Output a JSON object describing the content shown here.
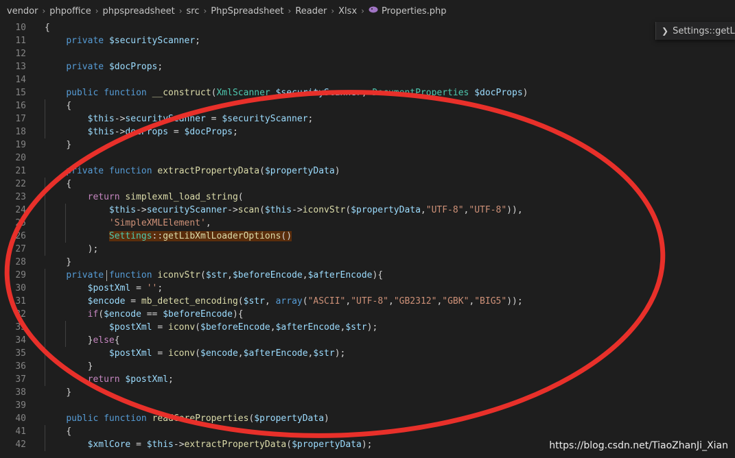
{
  "breadcrumb": {
    "items": [
      "vendor",
      "phpoffice",
      "phpspreadsheet",
      "src",
      "PhpSpreadsheet",
      "Reader",
      "Xlsx"
    ],
    "file": "Properties.php",
    "separator": "›"
  },
  "sticky_widget": {
    "label": "Settings::getLibX"
  },
  "watermark": "https://blog.csdn.net/TiaoZhanJi_Xian",
  "colors": {
    "background": "#1e1e1e",
    "keyword": "#569cd6",
    "control": "#c586c0",
    "variable": "#9cdcfe",
    "function": "#dcdcaa",
    "string": "#ce9178",
    "class": "#4ec9b0",
    "annotation_circle": "#e8302a"
  },
  "lines": [
    {
      "n": "10",
      "tokens": [
        [
          "pun",
          "{"
        ]
      ]
    },
    {
      "n": "11",
      "tokens": [
        [
          "sp",
          "    "
        ],
        [
          "kw",
          "private"
        ],
        [
          "sp",
          " "
        ],
        [
          "var",
          "$securityScanner"
        ],
        [
          "pun",
          ";"
        ]
      ]
    },
    {
      "n": "12",
      "tokens": []
    },
    {
      "n": "13",
      "tokens": [
        [
          "sp",
          "    "
        ],
        [
          "kw",
          "private"
        ],
        [
          "sp",
          " "
        ],
        [
          "var",
          "$docProps"
        ],
        [
          "pun",
          ";"
        ]
      ]
    },
    {
      "n": "14",
      "tokens": []
    },
    {
      "n": "15",
      "tokens": [
        [
          "sp",
          "    "
        ],
        [
          "kw",
          "public"
        ],
        [
          "sp",
          " "
        ],
        [
          "kw",
          "function"
        ],
        [
          "sp",
          " "
        ],
        [
          "fn",
          "__construct"
        ],
        [
          "pun",
          "("
        ],
        [
          "cls",
          "XmlScanner"
        ],
        [
          "sp",
          " "
        ],
        [
          "var",
          "$securityScanner"
        ],
        [
          "pun",
          ", "
        ],
        [
          "cls",
          "DocumentProperties"
        ],
        [
          "sp",
          " "
        ],
        [
          "var",
          "$docProps"
        ],
        [
          "pun",
          ")"
        ]
      ]
    },
    {
      "n": "16",
      "tokens": [
        [
          "sp",
          "    "
        ],
        [
          "pun",
          "{"
        ]
      ]
    },
    {
      "n": "17",
      "tokens": [
        [
          "sp",
          "        "
        ],
        [
          "var",
          "$this"
        ],
        [
          "pun",
          "->"
        ],
        [
          "var",
          "securityScanner"
        ],
        [
          "pun",
          " = "
        ],
        [
          "var",
          "$securityScanner"
        ],
        [
          "pun",
          ";"
        ]
      ]
    },
    {
      "n": "18",
      "tokens": [
        [
          "sp",
          "        "
        ],
        [
          "var",
          "$this"
        ],
        [
          "pun",
          "->"
        ],
        [
          "var",
          "docProps"
        ],
        [
          "pun",
          " = "
        ],
        [
          "var",
          "$docProps"
        ],
        [
          "pun",
          ";"
        ]
      ]
    },
    {
      "n": "19",
      "tokens": [
        [
          "sp",
          "    "
        ],
        [
          "pun",
          "}"
        ]
      ]
    },
    {
      "n": "20",
      "tokens": []
    },
    {
      "n": "21",
      "tokens": [
        [
          "sp",
          "    "
        ],
        [
          "kw",
          "private"
        ],
        [
          "sp",
          " "
        ],
        [
          "kw",
          "function"
        ],
        [
          "sp",
          " "
        ],
        [
          "fn",
          "extractPropertyData"
        ],
        [
          "pun",
          "("
        ],
        [
          "var",
          "$propertyData"
        ],
        [
          "pun",
          ")"
        ]
      ]
    },
    {
      "n": "22",
      "tokens": [
        [
          "sp",
          "    "
        ],
        [
          "pun",
          "{"
        ]
      ]
    },
    {
      "n": "23",
      "tokens": [
        [
          "sp",
          "        "
        ],
        [
          "ctl",
          "return"
        ],
        [
          "sp",
          " "
        ],
        [
          "fn",
          "simplexml_load_string"
        ],
        [
          "pun",
          "("
        ]
      ]
    },
    {
      "n": "24",
      "tokens": [
        [
          "sp",
          "            "
        ],
        [
          "var",
          "$this"
        ],
        [
          "pun",
          "->"
        ],
        [
          "var",
          "securityScanner"
        ],
        [
          "pun",
          "->"
        ],
        [
          "fn",
          "scan"
        ],
        [
          "pun",
          "("
        ],
        [
          "var",
          "$this"
        ],
        [
          "pun",
          "->"
        ],
        [
          "fn",
          "iconvStr"
        ],
        [
          "pun",
          "("
        ],
        [
          "var",
          "$propertyData"
        ],
        [
          "pun",
          ","
        ],
        [
          "str",
          "\"UTF-8\""
        ],
        [
          "pun",
          ","
        ],
        [
          "str",
          "\"UTF-8\""
        ],
        [
          "pun",
          ")),"
        ]
      ]
    },
    {
      "n": "25",
      "tokens": [
        [
          "sp",
          "            "
        ],
        [
          "str",
          "'SimpleXMLElement'"
        ],
        [
          "pun",
          ","
        ]
      ]
    },
    {
      "n": "26",
      "tokens": [
        [
          "sp",
          "            "
        ],
        [
          "hlcls",
          "Settings"
        ],
        [
          "hlpun",
          "::"
        ],
        [
          "hlfn",
          "getLibXmlLoaderOptions"
        ],
        [
          "hlpun",
          "()"
        ]
      ]
    },
    {
      "n": "27",
      "tokens": [
        [
          "sp",
          "        "
        ],
        [
          "pun",
          ");"
        ]
      ]
    },
    {
      "n": "28",
      "tokens": [
        [
          "sp",
          "    "
        ],
        [
          "pun",
          "}"
        ]
      ]
    },
    {
      "n": "29",
      "tokens": [
        [
          "sp",
          "    "
        ],
        [
          "kw",
          "private"
        ],
        [
          "sp",
          " "
        ],
        [
          "kw",
          "function"
        ],
        [
          "sp",
          " "
        ],
        [
          "fn",
          "iconvStr"
        ],
        [
          "pun",
          "("
        ],
        [
          "var",
          "$str"
        ],
        [
          "pun",
          ","
        ],
        [
          "var",
          "$beforeEncode"
        ],
        [
          "pun",
          ","
        ],
        [
          "var",
          "$afterEncode"
        ],
        [
          "pun",
          "){"
        ]
      ]
    },
    {
      "n": "30",
      "tokens": [
        [
          "sp",
          "        "
        ],
        [
          "var",
          "$postXml"
        ],
        [
          "pun",
          " = "
        ],
        [
          "str",
          "''"
        ],
        [
          "pun",
          ";"
        ]
      ]
    },
    {
      "n": "31",
      "tokens": [
        [
          "sp",
          "        "
        ],
        [
          "var",
          "$encode"
        ],
        [
          "pun",
          " = "
        ],
        [
          "fn",
          "mb_detect_encoding"
        ],
        [
          "pun",
          "("
        ],
        [
          "var",
          "$str"
        ],
        [
          "pun",
          ", "
        ],
        [
          "kw",
          "array"
        ],
        [
          "pun",
          "("
        ],
        [
          "str",
          "\"ASCII\""
        ],
        [
          "pun",
          ","
        ],
        [
          "str",
          "\"UTF-8\""
        ],
        [
          "pun",
          ","
        ],
        [
          "str",
          "\"GB2312\""
        ],
        [
          "pun",
          ","
        ],
        [
          "str",
          "\"GBK\""
        ],
        [
          "pun",
          ","
        ],
        [
          "str",
          "\"BIG5\""
        ],
        [
          "pun",
          "));"
        ]
      ]
    },
    {
      "n": "32",
      "tokens": [
        [
          "sp",
          "        "
        ],
        [
          "ctl",
          "if"
        ],
        [
          "pun",
          "("
        ],
        [
          "var",
          "$encode"
        ],
        [
          "pun",
          " == "
        ],
        [
          "var",
          "$beforeEncode"
        ],
        [
          "pun",
          "){"
        ]
      ]
    },
    {
      "n": "33",
      "tokens": [
        [
          "sp",
          "            "
        ],
        [
          "var",
          "$postXml"
        ],
        [
          "pun",
          " = "
        ],
        [
          "fn",
          "iconv"
        ],
        [
          "pun",
          "("
        ],
        [
          "var",
          "$beforeEncode"
        ],
        [
          "pun",
          ","
        ],
        [
          "var",
          "$afterEncode"
        ],
        [
          "pun",
          ","
        ],
        [
          "var",
          "$str"
        ],
        [
          "pun",
          ");"
        ]
      ]
    },
    {
      "n": "34",
      "tokens": [
        [
          "sp",
          "        "
        ],
        [
          "pun",
          "}"
        ],
        [
          "ctl",
          "else"
        ],
        [
          "pun",
          "{"
        ]
      ]
    },
    {
      "n": "35",
      "tokens": [
        [
          "sp",
          "            "
        ],
        [
          "var",
          "$postXml"
        ],
        [
          "pun",
          " = "
        ],
        [
          "fn",
          "iconv"
        ],
        [
          "pun",
          "("
        ],
        [
          "var",
          "$encode"
        ],
        [
          "pun",
          ","
        ],
        [
          "var",
          "$afterEncode"
        ],
        [
          "pun",
          ","
        ],
        [
          "var",
          "$str"
        ],
        [
          "pun",
          ");"
        ]
      ]
    },
    {
      "n": "36",
      "tokens": [
        [
          "sp",
          "        "
        ],
        [
          "pun",
          "}"
        ]
      ]
    },
    {
      "n": "37",
      "tokens": [
        [
          "sp",
          "        "
        ],
        [
          "ctl",
          "return"
        ],
        [
          "sp",
          " "
        ],
        [
          "var",
          "$postXml"
        ],
        [
          "pun",
          ";"
        ]
      ]
    },
    {
      "n": "38",
      "tokens": [
        [
          "sp",
          "    "
        ],
        [
          "pun",
          "}"
        ]
      ]
    },
    {
      "n": "39",
      "tokens": []
    },
    {
      "n": "40",
      "tokens": [
        [
          "sp",
          "    "
        ],
        [
          "kw",
          "public"
        ],
        [
          "sp",
          " "
        ],
        [
          "kw",
          "function"
        ],
        [
          "sp",
          " "
        ],
        [
          "fn",
          "readCoreProperties"
        ],
        [
          "pun",
          "("
        ],
        [
          "var",
          "$propertyData"
        ],
        [
          "pun",
          ")"
        ]
      ]
    },
    {
      "n": "41",
      "tokens": [
        [
          "sp",
          "    "
        ],
        [
          "pun",
          "{"
        ]
      ]
    },
    {
      "n": "42",
      "tokens": [
        [
          "sp",
          "        "
        ],
        [
          "var",
          "$xmlCore"
        ],
        [
          "pun",
          " = "
        ],
        [
          "var",
          "$this"
        ],
        [
          "pun",
          "->"
        ],
        [
          "fn",
          "extractPropertyData"
        ],
        [
          "pun",
          "("
        ],
        [
          "var",
          "$propertyData"
        ],
        [
          "pun",
          ");"
        ]
      ]
    }
  ]
}
